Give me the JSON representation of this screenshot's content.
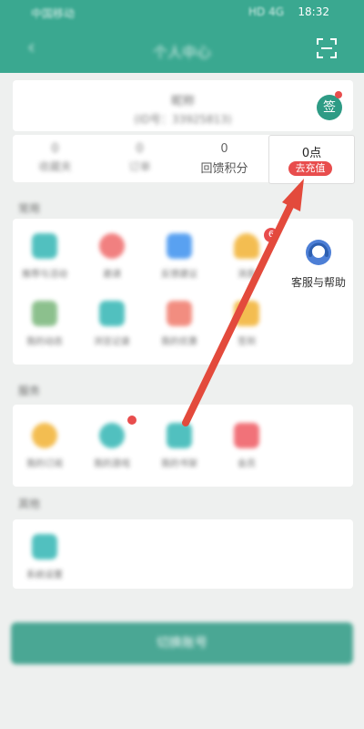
{
  "status_bar": {
    "left_text": "中国移动",
    "time": "18:32",
    "icons_text": "HD 4G"
  },
  "header": {
    "title": "个人中心",
    "back_icon": "back-arrow-icon",
    "scan_icon": "scan-icon"
  },
  "profile": {
    "name": "昵称",
    "id_text": "(ID号：33925813)",
    "sign_label": "签"
  },
  "stats": [
    {
      "value": "0",
      "label": "收藏夹"
    },
    {
      "value": "0",
      "label": "订单"
    },
    {
      "value": "0",
      "label": "回馈积分"
    },
    {
      "value": "0点",
      "label": "去充值"
    }
  ],
  "sections": {
    "common": {
      "title": "常用"
    },
    "services": {
      "title": "服务"
    },
    "other": {
      "title": "其他"
    }
  },
  "common_items": [
    {
      "label": "推荐与活动",
      "color": "#33b6b4"
    },
    {
      "label": "邀请",
      "color": "#ef6a6a"
    },
    {
      "label": "反馈建议",
      "color": "#3d91ef"
    },
    {
      "label": "消息",
      "color": "#f2b233",
      "badge": "6"
    },
    {
      "label": "客服与帮助",
      "color": "#4d7fd6"
    },
    {
      "label": "我的动态",
      "color": "#79b67a"
    },
    {
      "label": "浏览记录",
      "color": "#33b6b4"
    },
    {
      "label": "我的优惠",
      "color": "#f07a6b"
    },
    {
      "label": "签到",
      "color": "#f2b233"
    }
  ],
  "service_items": [
    {
      "label": "我的订阅",
      "color": "#f2b233"
    },
    {
      "label": "我的游戏",
      "color": "#33b6b4"
    },
    {
      "label": "我的书架",
      "color": "#33b6b4"
    },
    {
      "label": "会员",
      "color": "#ef5a62"
    }
  ],
  "other_items": [
    {
      "label": "系统设置",
      "color": "#33b6b4"
    }
  ],
  "bottom_button": {
    "label": "切换账号"
  },
  "colors": {
    "primary": "#3aa890",
    "accent": "#e84d4d"
  }
}
